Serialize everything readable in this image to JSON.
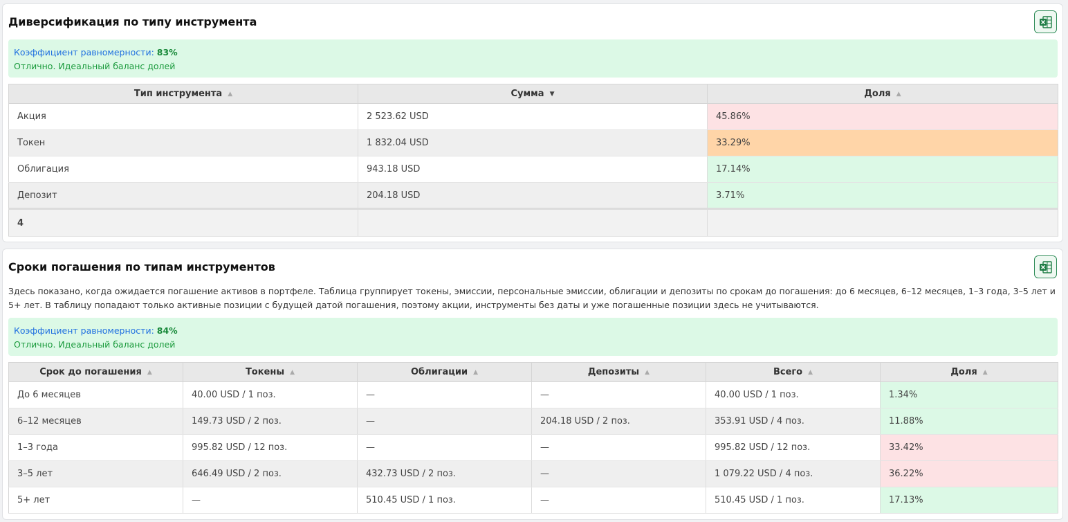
{
  "colors": {
    "red": "#fde2e4",
    "orange": "#ffd5a8",
    "green": "#dcf9e6"
  },
  "section1": {
    "title": "Диверсификация по типу инструмента",
    "excel_icon": "excel-icon",
    "coef_label": "Коэффициент равномерности:",
    "coef_value": "83%",
    "coef_note": "Отлично. Идеальный баланс долей",
    "columns": [
      "Тип инструмента",
      "Сумма",
      "Доля"
    ],
    "rows": [
      {
        "type": "Акция",
        "sum": "2 523.62 USD",
        "share": "45.86%",
        "level": "red"
      },
      {
        "type": "Токен",
        "sum": "1 832.04 USD",
        "share": "33.29%",
        "level": "orange"
      },
      {
        "type": "Облигация",
        "sum": "943.18 USD",
        "share": "17.14%",
        "level": "green"
      },
      {
        "type": "Депозит",
        "sum": "204.18 USD",
        "share": "3.71%",
        "level": "green"
      }
    ],
    "footer_count": "4"
  },
  "section2": {
    "title": "Сроки погашения по типам инструментов",
    "excel_icon": "excel-icon",
    "description": "Здесь показано, когда ожидается погашение активов в портфеле. Таблица группирует токены, эмиссии, персональные эмиссии, облигации и депозиты по срокам до погашения: до 6 месяцев, 6–12 месяцев, 1–3 года, 3–5 лет и 5+ лет. В таблицу попадают только активные позиции с будущей датой погашения, поэтому акции, инструменты без даты и уже погашенные позиции здесь не учитываются.",
    "coef_label": "Коэффициент равномерности:",
    "coef_value": "84%",
    "coef_note": "Отлично. Идеальный баланс долей",
    "columns": [
      "Срок до погашения",
      "Токены",
      "Облигации",
      "Депозиты",
      "Всего",
      "Доля"
    ],
    "rows": [
      {
        "term": "До 6 месяцев",
        "tokens": "40.00 USD / 1 поз.",
        "bonds": "—",
        "deposits": "—",
        "total": "40.00 USD / 1 поз.",
        "share": "1.34%",
        "level": "green"
      },
      {
        "term": "6–12 месяцев",
        "tokens": "149.73 USD / 2 поз.",
        "bonds": "—",
        "deposits": "204.18 USD / 2 поз.",
        "total": "353.91 USD / 4 поз.",
        "share": "11.88%",
        "level": "green"
      },
      {
        "term": "1–3 года",
        "tokens": "995.82 USD / 12 поз.",
        "bonds": "—",
        "deposits": "—",
        "total": "995.82 USD / 12 поз.",
        "share": "33.42%",
        "level": "red"
      },
      {
        "term": "3–5 лет",
        "tokens": "646.49 USD / 2 поз.",
        "bonds": "432.73 USD / 2 поз.",
        "deposits": "—",
        "total": "1 079.22 USD / 4 поз.",
        "share": "36.22%",
        "level": "red"
      },
      {
        "term": "5+ лет",
        "tokens": "—",
        "bonds": "510.45 USD / 1 поз.",
        "deposits": "—",
        "total": "510.45 USD / 1 поз.",
        "share": "17.13%",
        "level": "green"
      }
    ]
  }
}
